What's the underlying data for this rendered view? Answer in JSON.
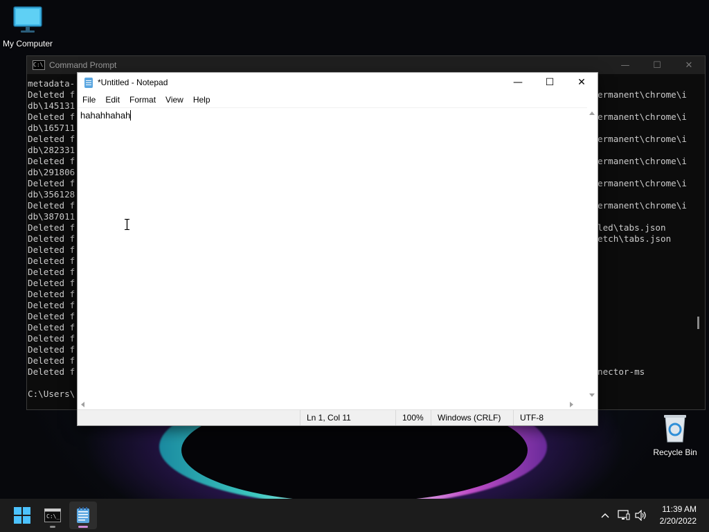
{
  "desktop": {
    "icons": [
      {
        "label": "My Computer"
      },
      {
        "label": "Recycle Bin"
      }
    ]
  },
  "cmd": {
    "title": "Command Prompt",
    "left_lines": [
      "metadata-",
      "Deleted f",
      "db\\145131",
      "Deleted f",
      "db\\165711",
      "Deleted f",
      "db\\282331",
      "Deleted f",
      "db\\291806",
      "Deleted f",
      "db\\356128",
      "Deleted f",
      "db\\387011",
      "Deleted f",
      "Deleted f",
      "Deleted f",
      "Deleted f",
      "Deleted f",
      "Deleted f",
      "Deleted f",
      "Deleted f",
      "Deleted f",
      "Deleted f",
      "Deleted f",
      "Deleted f",
      "Deleted f",
      "Deleted f",
      "",
      "C:\\Users\\"
    ],
    "right_lines": [
      "",
      "ermanent\\chrome\\i",
      "",
      "ermanent\\chrome\\i",
      "",
      "ermanent\\chrome\\i",
      "",
      "ermanent\\chrome\\i",
      "",
      "ermanent\\chrome\\i",
      "",
      "ermanent\\chrome\\i",
      "",
      "led\\tabs.json",
      "etch\\tabs.json",
      "",
      "",
      "",
      "",
      "",
      "",
      "",
      "",
      "",
      "",
      "",
      "nector-ms"
    ]
  },
  "notepad": {
    "title": "*Untitled - Notepad",
    "menu": [
      "File",
      "Edit",
      "Format",
      "View",
      "Help"
    ],
    "content": "hahahhahah",
    "status": {
      "position": "Ln 1, Col 11",
      "zoom": "100%",
      "line_ending": "Windows (CRLF)",
      "encoding": "UTF-8"
    }
  },
  "taskbar": {
    "apps": [
      "start",
      "command-prompt",
      "notepad"
    ],
    "time": "11:39 AM",
    "date": "2/20/2022"
  }
}
